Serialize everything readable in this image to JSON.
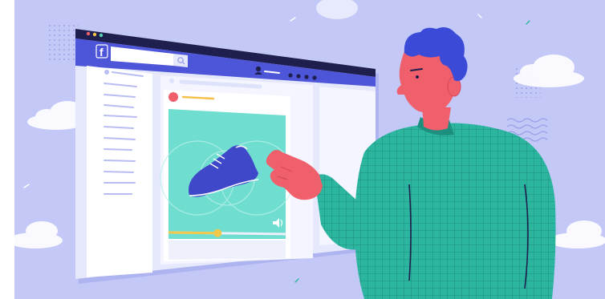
{
  "app": {
    "logo_letter": "f"
  },
  "colors": {
    "background": "#c3c8f7",
    "titlebar": "#1f1f4f",
    "navbar": "#4d56d9",
    "browser_body": "#e6e9fc",
    "sidebar": "#ffffff",
    "post_card": "#ffffff",
    "video_bg": "#6fded1",
    "progress_fill": "#f2c84b",
    "avatar": "#ef5f6c",
    "shoe": "#3f48c8",
    "shirt": "#2cb6a0",
    "skin": "#ef5f6c",
    "hair": "#3b4bd8",
    "traffic_lights": [
      "#ef5f6c",
      "#f5c04a",
      "#58d0b4"
    ]
  },
  "media": {
    "progress": 0.42,
    "icons": [
      "play-progress-handle",
      "speaker-icon"
    ]
  },
  "icons": {
    "search": "search-icon",
    "profile": "profile-icon",
    "more": "more-dots-icon"
  }
}
